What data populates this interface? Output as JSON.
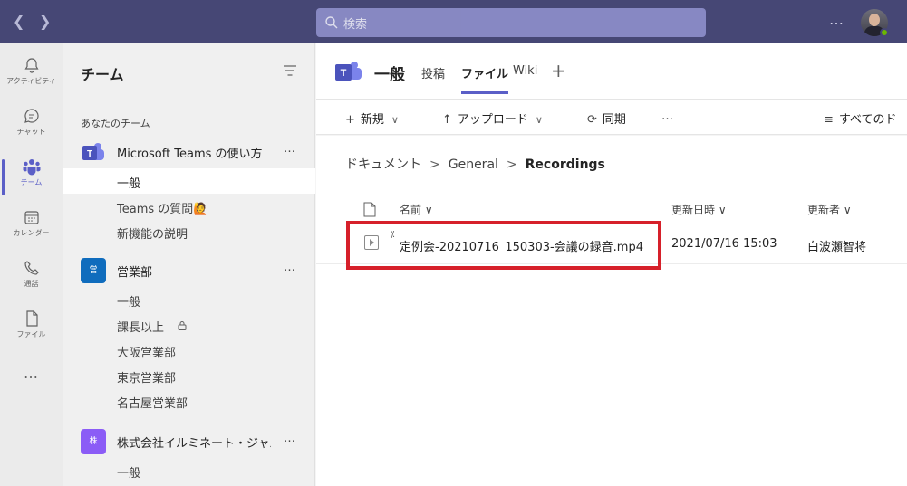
{
  "topbar": {
    "back_icon": "chevron-left-icon",
    "forward_icon": "chevron-right-icon",
    "search_placeholder": "検索",
    "more_label": "…"
  },
  "rail": {
    "items": [
      {
        "label": "アクティビティ",
        "icon": "bell-icon"
      },
      {
        "label": "チャット",
        "icon": "chat-icon"
      },
      {
        "label": "チーム",
        "icon": "teams-icon"
      },
      {
        "label": "カレンダー",
        "icon": "calendar-icon"
      },
      {
        "label": "通話",
        "icon": "phone-icon"
      },
      {
        "label": "ファイル",
        "icon": "file-icon"
      }
    ],
    "more_label": "…",
    "active_color": "#5b5fc7"
  },
  "teampane": {
    "title": "チーム",
    "section_label": "あなたのチーム",
    "teams": [
      {
        "name": "Microsoft Teams の使い方",
        "icon_text": "",
        "color": "#5b5fc7",
        "channels": [
          "一般",
          "Teams の質問🙋",
          "新機能の説明"
        ]
      },
      {
        "name": "営業部",
        "icon_text": "営",
        "color": "#0f6cbd",
        "channels": [
          "一般",
          "課長以上",
          "大阪営業部",
          "東京営業部",
          "名古屋営業部"
        ]
      },
      {
        "name": "株式会社イルミネート・ジャパ...",
        "icon_text": "株",
        "color": "#8b5cf6",
        "channels": [
          "一般"
        ]
      }
    ],
    "more_label": "…"
  },
  "main": {
    "channel_title": "一般",
    "tabs": [
      "投稿",
      "ファイル",
      "Wiki"
    ],
    "add_tab": "+",
    "toolbar": {
      "new_label": "新規",
      "upload_label": "アップロード",
      "sync_label": "同期",
      "more_label": "…",
      "view_label": "すべてのド"
    },
    "breadcrumb": [
      "ドキュメント",
      "General",
      "Recordings"
    ],
    "columns": {
      "name": "名前",
      "modified": "更新日時",
      "modified_by": "更新者"
    },
    "files": [
      {
        "name": "定例会-20210716_150303-会議の録音.mp4",
        "modified": "2021/07/16 15:03",
        "modified_by": "白波瀬智将"
      }
    ],
    "highlight_color": "#d6202a"
  }
}
